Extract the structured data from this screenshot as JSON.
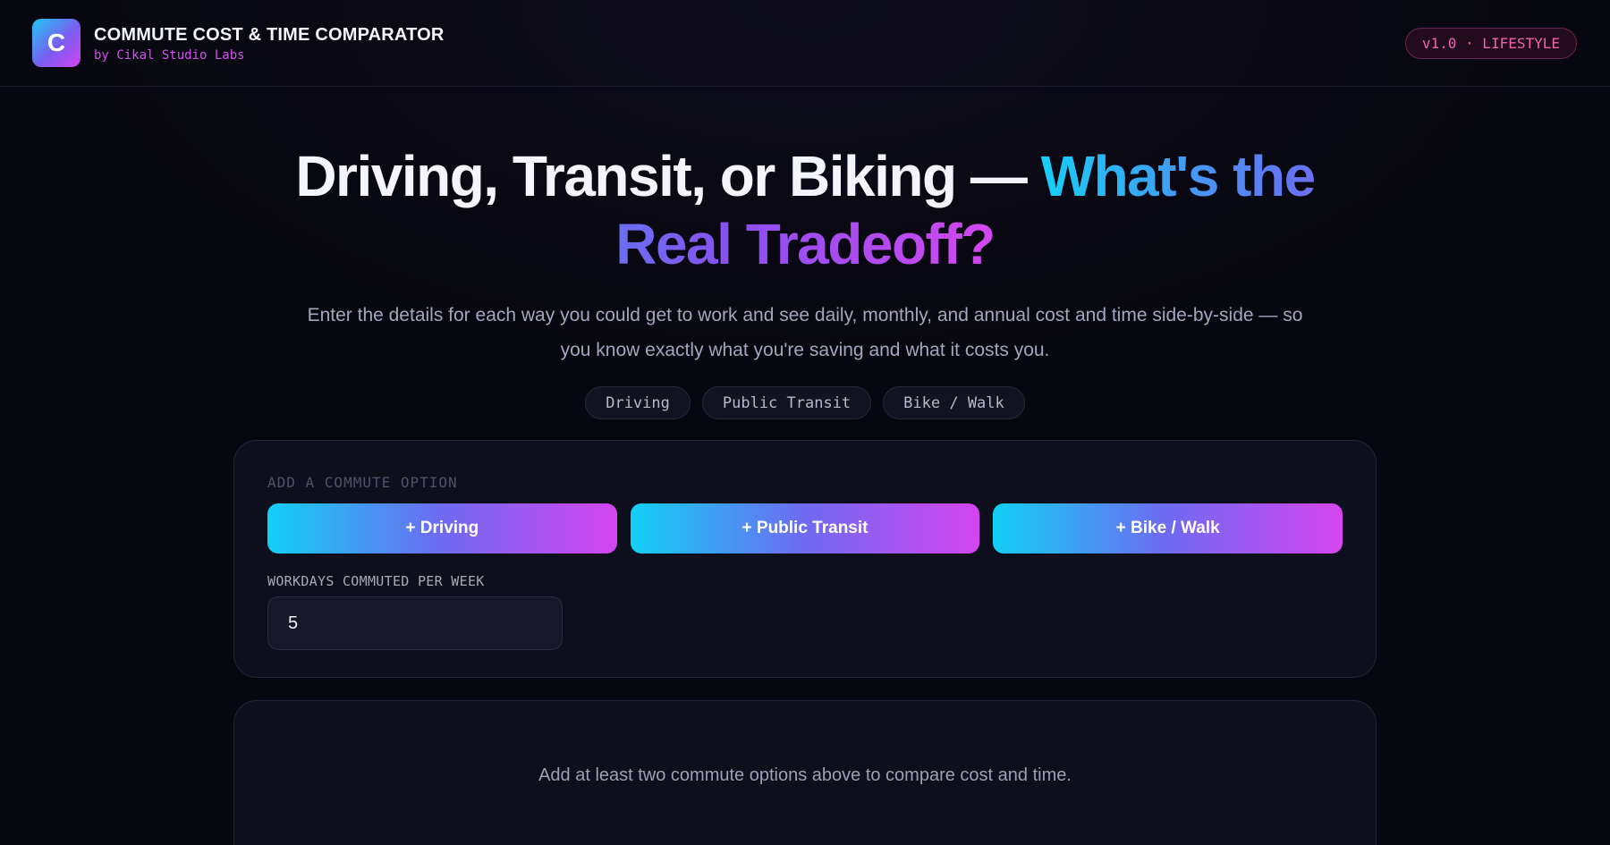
{
  "header": {
    "logo_letter": "C",
    "title": "COMMUTE COST & TIME COMPARATOR",
    "subtitle": "by Cikal Studio Labs",
    "version_badge": "v1.0 · LIFESTYLE"
  },
  "hero": {
    "title_plain": "Driving, Transit, or Biking — ",
    "title_highlight": "What's the Real Tradeoff?",
    "description": "Enter the details for each way you could get to work and see daily, monthly, and annual cost and time side-by-side — so you know exactly what you're saving and what it costs you.",
    "chips": [
      "Driving",
      "Public Transit",
      "Bike / Walk"
    ]
  },
  "add_panel": {
    "section_label": "ADD A COMMUTE OPTION",
    "buttons": [
      "+ Driving",
      "+ Public Transit",
      "+ Bike / Walk"
    ],
    "workdays_label": "WORKDAYS COMMUTED PER WEEK",
    "workdays_value": "5"
  },
  "results_panel": {
    "empty_message": "Add at least two commute options above to compare cost and time."
  },
  "colors": {
    "background": "#07070f",
    "accent_cyan": "#18cdf6",
    "accent_magenta": "#d545f0",
    "badge_pink": "#f062b0"
  }
}
